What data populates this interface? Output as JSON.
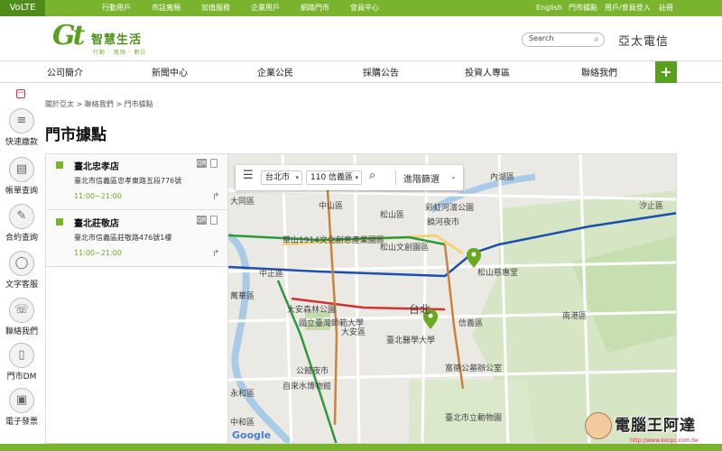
{
  "topbar": {
    "volte": "VoLTE",
    "links": [
      "行動用戶",
      "市話寬頻",
      "加值服務",
      "企業用戶",
      "網路門市",
      "會員中心"
    ],
    "right": [
      "English",
      "門市據點",
      "用戶/會員登入",
      "註冊"
    ]
  },
  "brand": {
    "logo_mark": "Gt",
    "logo_text": "智慧生活",
    "logo_sub": "行動 · 寬頻 · 數位",
    "search_placeholder": "Search",
    "company": "亞太電信"
  },
  "nav": {
    "items": [
      "公司簡介",
      "新聞中心",
      "企業公民",
      "採購公告",
      "投資人專區",
      "聯絡我們"
    ],
    "plus": "+"
  },
  "sidebar": {
    "collapse": "−",
    "items": [
      {
        "label": "快速繳款",
        "icon": "coin-stack-icon"
      },
      {
        "label": "帳單查詢",
        "icon": "bill-icon"
      },
      {
        "label": "合約查詢",
        "icon": "contract-icon"
      },
      {
        "label": "文字客服",
        "icon": "chat-icon"
      },
      {
        "label": "聯絡我們",
        "icon": "phone-icon"
      },
      {
        "label": "門市DM",
        "icon": "book-icon"
      },
      {
        "label": "電子發票",
        "icon": "invoice-icon"
      }
    ]
  },
  "breadcrumb": "關於亞太 > 聯絡我們 > 門市據點",
  "page_title": "門市據點",
  "stores": [
    {
      "name": "臺北忠孝店",
      "address": "臺北市信義區忠孝東路五段776號",
      "hours": "11:00~21:00"
    },
    {
      "name": "臺北莊敬店",
      "address": "臺北市信義區莊敬路476號1樓",
      "hours": "11:00~21:00"
    }
  ],
  "map": {
    "city": "台北市",
    "district": "110 信義區",
    "advanced_filter": "進階篩選",
    "google": "Google",
    "labels": [
      "大同區",
      "中山區",
      "松山區",
      "彩虹河濱公園",
      "內湖區",
      "饒河夜市",
      "松山文創園區",
      "松山慈惠堂",
      "中正區",
      "大安森林公園",
      "國立臺灣師範大學",
      "大安區",
      "台北",
      "信義區",
      "臺北醫學大學",
      "南港區",
      "公館夜市",
      "自來水博物館",
      "永和區",
      "富德公墓辦公室",
      "臺北市立動物園",
      "華山1914文化創意產業園區",
      "汐止區",
      "萬華區",
      "中和區"
    ]
  },
  "watermark": {
    "text": "電腦王阿達",
    "url": "http://www.kocpc.com.tw"
  },
  "colors": {
    "brand_green": "#7ab32e",
    "dark_green": "#4f8d1b",
    "pin_green": "#6aaa1e"
  }
}
